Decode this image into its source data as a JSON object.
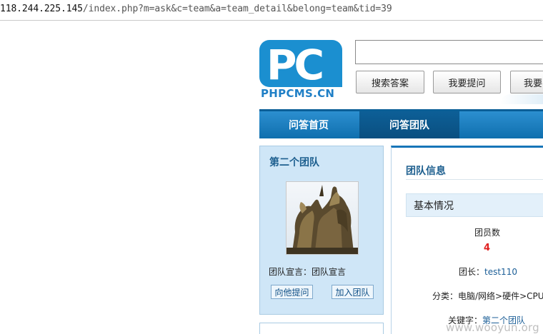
{
  "browser": {
    "url_host": "118.244.225.145",
    "url_path": "/index.php?m=ask&c=team&a=team_detail&belong=team&tid=39"
  },
  "header": {
    "logo_text": "PC",
    "logo_brand": "PHPCMS.CN",
    "search_placeholder": "",
    "buttons": {
      "search": "搜索答案",
      "ask": "我要提问",
      "more": "我要"
    }
  },
  "nav": {
    "items": [
      {
        "label": "问答首页",
        "active": false
      },
      {
        "label": "问答团队",
        "active": true
      }
    ]
  },
  "sidebar": {
    "team_name": "第二个团队",
    "photo_icon": "team-photo-horses-statue",
    "motto": "团队宣言：团队宣言",
    "ask_button": "向他提问",
    "join_button": "加入团队"
  },
  "main": {
    "section_title": "团队信息",
    "basic_title": "基本情况",
    "member_count_label": "团员数",
    "member_count": "4",
    "leader_prefix": "团长：",
    "leader_name": "test110",
    "category": "分类：电脑/网络>硬件>CPU",
    "keyword_prefix": "关键字：",
    "keyword_value": "第二个团队"
  },
  "watermark": "www.wooyun.org",
  "colors": {
    "brand_blue": "#1b8fd0",
    "nav_blue": "#1775b8",
    "nav_active": "#0d5f97",
    "sidebar_bg": "#cfe6f7",
    "count_red": "#e02020"
  }
}
